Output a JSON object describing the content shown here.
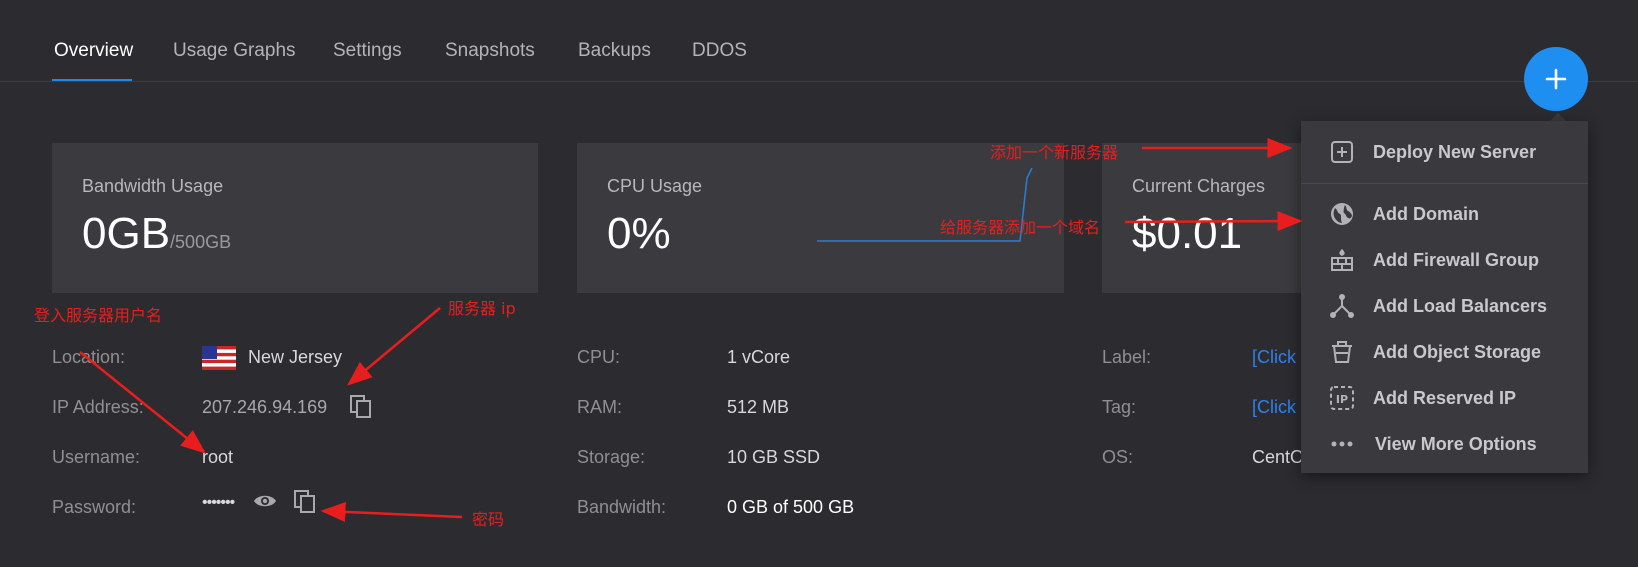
{
  "tabs": [
    {
      "label": "Overview",
      "active": true
    },
    {
      "label": "Usage Graphs"
    },
    {
      "label": "Settings"
    },
    {
      "label": "Snapshots"
    },
    {
      "label": "Backups"
    },
    {
      "label": "DDOS"
    }
  ],
  "cards": {
    "bandwidth": {
      "title": "Bandwidth Usage",
      "value": "0GB",
      "sub": "/500GB"
    },
    "cpu": {
      "title": "CPU Usage",
      "value": "0%"
    },
    "charges": {
      "title": "Current Charges",
      "value": "$0.01"
    }
  },
  "server": {
    "location_label": "Location:",
    "location_value": "New Jersey",
    "location_flag": "us-flag-icon",
    "ip_label": "IP Address:",
    "ip_value": "207.246.94.169",
    "username_label": "Username:",
    "username_value": "root",
    "password_label": "Password:",
    "password_value": "•••••••",
    "cpu_label": "CPU:",
    "cpu_value": "1 vCore",
    "ram_label": "RAM:",
    "ram_value": "512 MB",
    "storage_label": "Storage:",
    "storage_value": "10 GB SSD",
    "bandwidth_label": "Bandwidth:",
    "bandwidth_value": "0 GB of 500 GB",
    "label_label": "Label:",
    "label_value": "[Click",
    "tag_label": "Tag:",
    "tag_value": "[Click",
    "os_label": "OS:",
    "os_value": "CentO"
  },
  "menu": {
    "items": [
      {
        "label": "Deploy New Server",
        "icon": "plus-square-icon"
      },
      {
        "label": "Add Domain",
        "icon": "globe-icon"
      },
      {
        "label": "Add Firewall Group",
        "icon": "firewall-icon"
      },
      {
        "label": "Add Load Balancers",
        "icon": "load-balancer-icon"
      },
      {
        "label": "Add Object Storage",
        "icon": "bucket-icon"
      },
      {
        "label": "Add Reserved IP",
        "icon": "reserved-ip-icon"
      },
      {
        "label": "View More Options",
        "icon": "more-dots-icon"
      }
    ]
  },
  "annotations": {
    "deploy": "添加一个新服务器",
    "domain": "给服务器添加一个域名",
    "username": "登入服务器用户名",
    "ip": "服务器 ip",
    "password": "密码"
  },
  "colors": {
    "background": "#2c2c30",
    "card": "#3b3b3f",
    "accent": "#1f8ef1",
    "link": "#2f80ed",
    "annotation": "#e81e1e"
  }
}
